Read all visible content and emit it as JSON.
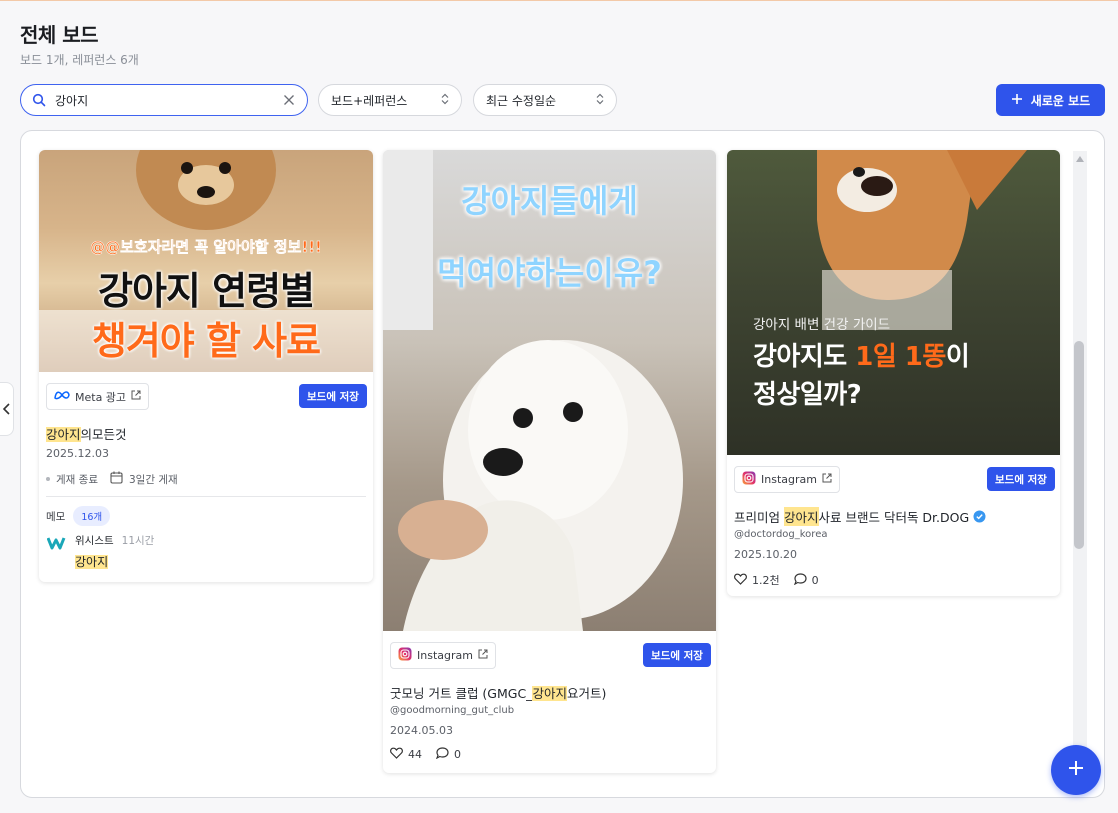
{
  "header": {
    "title": "전체 보드",
    "subtitle": "보드 1개, 레퍼런스 6개"
  },
  "search": {
    "value": "강아지",
    "placeholder": ""
  },
  "filters": {
    "type_select": "보드+레퍼런스",
    "sort_select": "최근 수정일순"
  },
  "new_board_label": "새로운 보드",
  "cards": [
    {
      "thumb_text_top": "@@보호자라면 꼭 알아야할 정보!!!",
      "thumb_text_main": "강아지 연령별",
      "thumb_text_sub": "챙겨야 할 사료",
      "source": "Meta 광고",
      "save_label": "보드에 저장",
      "title_hl": "강아지",
      "title_rest": "의모든것",
      "date": "2025.12.03",
      "status": "게재 종료",
      "duration": "3일간 게재",
      "memo_label": "메모",
      "memo_count": "16개",
      "memo_author": "위시스트",
      "memo_time": "11시간",
      "memo_text": "강아지"
    },
    {
      "thumb_text_line1": "강아지들에게",
      "thumb_text_line2": "먹여야하는이유?",
      "source": "Instagram",
      "save_label": "보드에 저장",
      "title_pre": "굿모닝 거트 클럽 (GMGC_",
      "title_hl": "강아지",
      "title_post": "요거트)",
      "handle": "@goodmorning_gut_club",
      "date": "2024.05.03",
      "likes": "44",
      "comments": "0"
    },
    {
      "thumb_text_small": "강아지 배변 건강 가이드",
      "thumb_text_line1_a": "강아지도 ",
      "thumb_text_line1_b": "1일 1똥",
      "thumb_text_line1_c": "이",
      "thumb_text_line2": "정상일까?",
      "source": "Instagram",
      "save_label": "보드에 저장",
      "title_pre": "프리미엄 ",
      "title_hl": "강아지",
      "title_post": "사료 브랜드 닥터독 Dr.DOG",
      "handle": "@doctordog_korea",
      "date": "2025.10.20",
      "likes": "1.2천",
      "comments": "0"
    }
  ],
  "colors": {
    "accent": "#2f54eb",
    "highlight": "#ffe58f",
    "orange": "#ff6a1a"
  }
}
